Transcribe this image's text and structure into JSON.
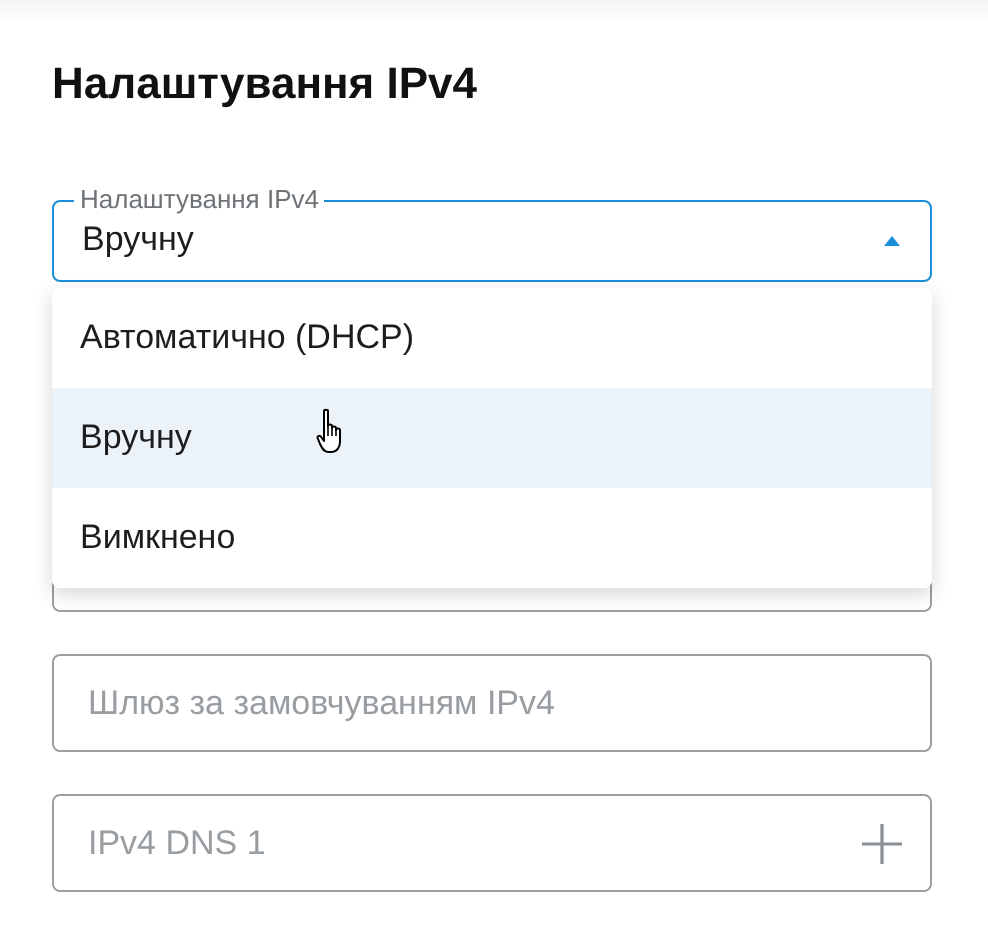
{
  "title": "Налаштування IPv4",
  "select": {
    "label": "Налаштування IPv4",
    "value": "Вручну",
    "expanded": true,
    "options": [
      {
        "label": "Автоматично (DHCP)",
        "selected": false
      },
      {
        "label": "Вручну",
        "selected": true
      },
      {
        "label": "Вимкнено",
        "selected": false
      }
    ]
  },
  "fields": [
    {
      "kind": "covered"
    },
    {
      "kind": "text",
      "placeholder": "Шлюз за замовчуванням IPv4"
    },
    {
      "kind": "add",
      "placeholder": "IPv4 DNS 1"
    }
  ]
}
